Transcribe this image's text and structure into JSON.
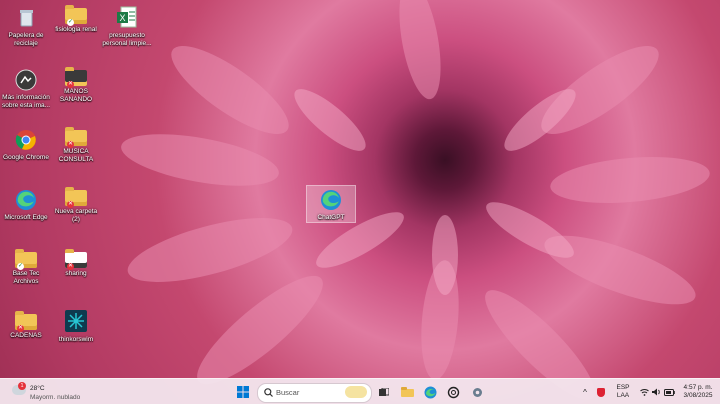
{
  "desktop": {
    "icons": [
      {
        "label": "Papelera de reciclaje"
      },
      {
        "label": "fisiologia renal"
      },
      {
        "label": "presupuesto personal limpie..."
      },
      {
        "label": "Más información sobre esta ima..."
      },
      {
        "label": "MANOS SANANDO"
      },
      {
        "label": "Google Chrome"
      },
      {
        "label": "MUSICA CONSULTA"
      },
      {
        "label": "Microsoft Edge"
      },
      {
        "label": "Nueva carpeta (2)"
      },
      {
        "label": "Base Tec Archivos"
      },
      {
        "label": "sharing"
      },
      {
        "label": "CADENAS"
      },
      {
        "label": "thinkorswim"
      },
      {
        "label": "ChatGPT"
      }
    ]
  },
  "taskbar": {
    "weather": {
      "temp": "28°C",
      "desc": "Mayorm. nublado",
      "badge": "1"
    },
    "search_placeholder": "Buscar",
    "lang_top": "ESP",
    "lang_bottom": "LAA",
    "time": "4:57 p. m.",
    "date": "3/08/2025"
  },
  "colors": {
    "taskbar_bg": "#f3e4ec",
    "accent": "#0078d4",
    "folder": "#f2c557"
  }
}
